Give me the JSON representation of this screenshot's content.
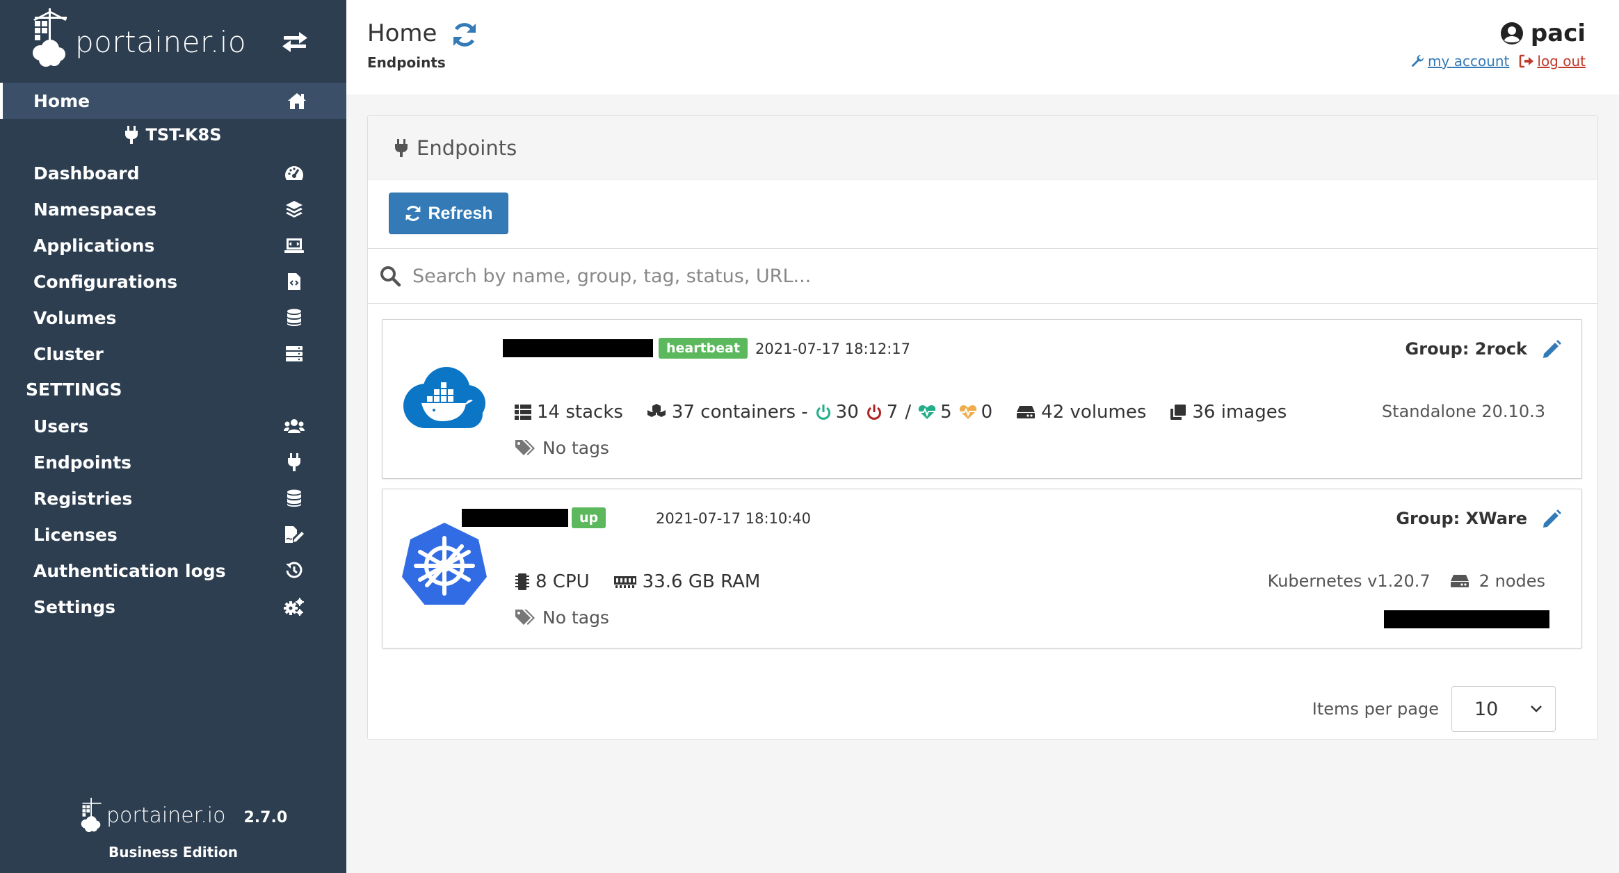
{
  "brand": {
    "logo_text": "portainer.io"
  },
  "sidebar": {
    "home": "Home",
    "environment": "TST-K8S",
    "items": [
      {
        "label": "Dashboard",
        "icon": "tachometer-icon"
      },
      {
        "label": "Namespaces",
        "icon": "layers-icon"
      },
      {
        "label": "Applications",
        "icon": "laptop-code-icon"
      },
      {
        "label": "Configurations",
        "icon": "file-code-icon"
      },
      {
        "label": "Volumes",
        "icon": "database-icon"
      },
      {
        "label": "Cluster",
        "icon": "server-icon"
      }
    ],
    "settings_heading": "SETTINGS",
    "settings_items": [
      {
        "label": "Users",
        "icon": "users-icon"
      },
      {
        "label": "Endpoints",
        "icon": "plug-icon"
      },
      {
        "label": "Registries",
        "icon": "database-icon"
      },
      {
        "label": "Licenses",
        "icon": "file-signature-icon"
      },
      {
        "label": "Authentication logs",
        "icon": "history-icon"
      },
      {
        "label": "Settings",
        "icon": "cogs-icon"
      }
    ],
    "footer": {
      "logo_text": "portainer.io",
      "version": "2.7.0",
      "edition": "Business Edition"
    }
  },
  "header": {
    "title": "Home",
    "breadcrumb": "Endpoints",
    "user": "paci",
    "my_account": "my account",
    "log_out": "log out"
  },
  "widget": {
    "title": "Endpoints",
    "refresh_label": "Refresh",
    "search_placeholder": "Search by name, group, tag, status, URL..."
  },
  "endpoints": [
    {
      "type": "docker",
      "status": "heartbeat",
      "date": "2021-07-17 18:12:17",
      "group": "Group: 2rock",
      "stacks": "14 stacks",
      "containers": "37 containers -",
      "running": "30",
      "stopped": "7",
      "slash": "/",
      "healthy": "5",
      "unhealthy": "0",
      "volumes": "42 volumes",
      "images": "36 images",
      "tags": "No tags",
      "platform": "Standalone 20.10.3"
    },
    {
      "type": "kubernetes",
      "status": "up",
      "date": "2021-07-17 18:10:40",
      "group": "Group: XWare",
      "cpu": "8 CPU",
      "ram": "33.6 GB RAM",
      "tags": "No tags",
      "platform": "Kubernetes v1.20.7",
      "nodes": "2 nodes"
    }
  ],
  "pagination": {
    "label": "Items per page",
    "value": "10"
  },
  "colors": {
    "sidebar_bg": "#2d3e50",
    "primary": "#337ab7",
    "badge_green": "#5cb85c",
    "running_green": "#23ae89",
    "stopped_red": "#ae2323",
    "unhealthy_orange": "#f0ad4e",
    "docker_blue": "#0b75c6",
    "k8s_blue": "#326ce5"
  }
}
